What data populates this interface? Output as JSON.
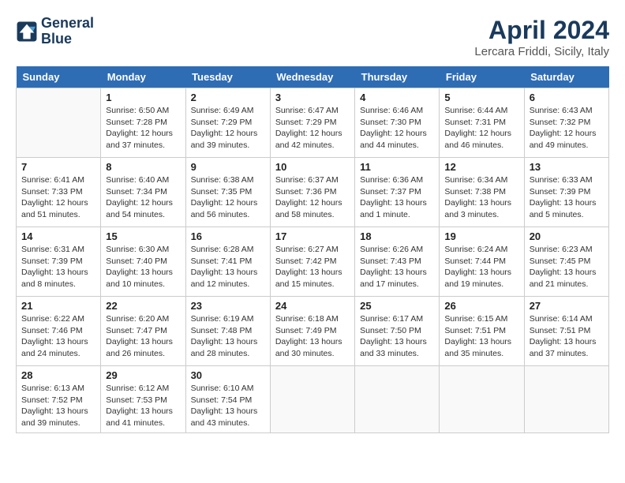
{
  "header": {
    "logo_line1": "General",
    "logo_line2": "Blue",
    "title": "April 2024",
    "location": "Lercara Friddi, Sicily, Italy"
  },
  "calendar": {
    "days_of_week": [
      "Sunday",
      "Monday",
      "Tuesday",
      "Wednesday",
      "Thursday",
      "Friday",
      "Saturday"
    ],
    "weeks": [
      [
        {
          "day": "",
          "content": ""
        },
        {
          "day": "1",
          "content": "Sunrise: 6:50 AM\nSunset: 7:28 PM\nDaylight: 12 hours\nand 37 minutes."
        },
        {
          "day": "2",
          "content": "Sunrise: 6:49 AM\nSunset: 7:29 PM\nDaylight: 12 hours\nand 39 minutes."
        },
        {
          "day": "3",
          "content": "Sunrise: 6:47 AM\nSunset: 7:29 PM\nDaylight: 12 hours\nand 42 minutes."
        },
        {
          "day": "4",
          "content": "Sunrise: 6:46 AM\nSunset: 7:30 PM\nDaylight: 12 hours\nand 44 minutes."
        },
        {
          "day": "5",
          "content": "Sunrise: 6:44 AM\nSunset: 7:31 PM\nDaylight: 12 hours\nand 46 minutes."
        },
        {
          "day": "6",
          "content": "Sunrise: 6:43 AM\nSunset: 7:32 PM\nDaylight: 12 hours\nand 49 minutes."
        }
      ],
      [
        {
          "day": "7",
          "content": "Sunrise: 6:41 AM\nSunset: 7:33 PM\nDaylight: 12 hours\nand 51 minutes."
        },
        {
          "day": "8",
          "content": "Sunrise: 6:40 AM\nSunset: 7:34 PM\nDaylight: 12 hours\nand 54 minutes."
        },
        {
          "day": "9",
          "content": "Sunrise: 6:38 AM\nSunset: 7:35 PM\nDaylight: 12 hours\nand 56 minutes."
        },
        {
          "day": "10",
          "content": "Sunrise: 6:37 AM\nSunset: 7:36 PM\nDaylight: 12 hours\nand 58 minutes."
        },
        {
          "day": "11",
          "content": "Sunrise: 6:36 AM\nSunset: 7:37 PM\nDaylight: 13 hours\nand 1 minute."
        },
        {
          "day": "12",
          "content": "Sunrise: 6:34 AM\nSunset: 7:38 PM\nDaylight: 13 hours\nand 3 minutes."
        },
        {
          "day": "13",
          "content": "Sunrise: 6:33 AM\nSunset: 7:39 PM\nDaylight: 13 hours\nand 5 minutes."
        }
      ],
      [
        {
          "day": "14",
          "content": "Sunrise: 6:31 AM\nSunset: 7:39 PM\nDaylight: 13 hours\nand 8 minutes."
        },
        {
          "day": "15",
          "content": "Sunrise: 6:30 AM\nSunset: 7:40 PM\nDaylight: 13 hours\nand 10 minutes."
        },
        {
          "day": "16",
          "content": "Sunrise: 6:28 AM\nSunset: 7:41 PM\nDaylight: 13 hours\nand 12 minutes."
        },
        {
          "day": "17",
          "content": "Sunrise: 6:27 AM\nSunset: 7:42 PM\nDaylight: 13 hours\nand 15 minutes."
        },
        {
          "day": "18",
          "content": "Sunrise: 6:26 AM\nSunset: 7:43 PM\nDaylight: 13 hours\nand 17 minutes."
        },
        {
          "day": "19",
          "content": "Sunrise: 6:24 AM\nSunset: 7:44 PM\nDaylight: 13 hours\nand 19 minutes."
        },
        {
          "day": "20",
          "content": "Sunrise: 6:23 AM\nSunset: 7:45 PM\nDaylight: 13 hours\nand 21 minutes."
        }
      ],
      [
        {
          "day": "21",
          "content": "Sunrise: 6:22 AM\nSunset: 7:46 PM\nDaylight: 13 hours\nand 24 minutes."
        },
        {
          "day": "22",
          "content": "Sunrise: 6:20 AM\nSunset: 7:47 PM\nDaylight: 13 hours\nand 26 minutes."
        },
        {
          "day": "23",
          "content": "Sunrise: 6:19 AM\nSunset: 7:48 PM\nDaylight: 13 hours\nand 28 minutes."
        },
        {
          "day": "24",
          "content": "Sunrise: 6:18 AM\nSunset: 7:49 PM\nDaylight: 13 hours\nand 30 minutes."
        },
        {
          "day": "25",
          "content": "Sunrise: 6:17 AM\nSunset: 7:50 PM\nDaylight: 13 hours\nand 33 minutes."
        },
        {
          "day": "26",
          "content": "Sunrise: 6:15 AM\nSunset: 7:51 PM\nDaylight: 13 hours\nand 35 minutes."
        },
        {
          "day": "27",
          "content": "Sunrise: 6:14 AM\nSunset: 7:51 PM\nDaylight: 13 hours\nand 37 minutes."
        }
      ],
      [
        {
          "day": "28",
          "content": "Sunrise: 6:13 AM\nSunset: 7:52 PM\nDaylight: 13 hours\nand 39 minutes."
        },
        {
          "day": "29",
          "content": "Sunrise: 6:12 AM\nSunset: 7:53 PM\nDaylight: 13 hours\nand 41 minutes."
        },
        {
          "day": "30",
          "content": "Sunrise: 6:10 AM\nSunset: 7:54 PM\nDaylight: 13 hours\nand 43 minutes."
        },
        {
          "day": "",
          "content": ""
        },
        {
          "day": "",
          "content": ""
        },
        {
          "day": "",
          "content": ""
        },
        {
          "day": "",
          "content": ""
        }
      ]
    ]
  }
}
